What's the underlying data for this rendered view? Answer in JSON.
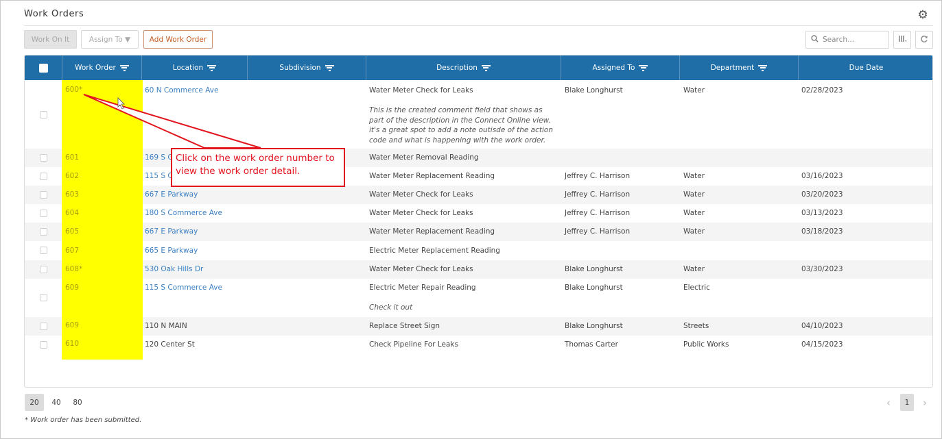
{
  "page": {
    "title": "Work Orders"
  },
  "toolbar": {
    "work_on_it": "Work On It",
    "assign_to": "Assign To ▼",
    "add_work_order": "Add Work Order",
    "search_placeholder": "Search..."
  },
  "columns": [
    "Work Order",
    "Location",
    "Subdivision",
    "Description",
    "Assigned To",
    "Department",
    "Due Date"
  ],
  "rows": [
    {
      "wo": "600*",
      "location": "60 N Commerce Ave",
      "location_link": true,
      "subdivision": "",
      "description": "Water Meter Check for Leaks",
      "note": "This is the created comment field that shows as part of the description in the Connect Online view. it's a great spot to add a note outisde of the action code and what is happening with the work order.",
      "assigned": "Blake Longhurst",
      "department": "Water",
      "due": "02/28/2023"
    },
    {
      "wo": "601",
      "location": "169 S Co",
      "location_link": true,
      "subdivision": "",
      "description": "Water Meter Removal Reading",
      "note": "",
      "assigned": "",
      "department": "",
      "due": ""
    },
    {
      "wo": "602",
      "location": "115 S Co",
      "location_link": true,
      "subdivision": "",
      "description": "Water Meter Replacement Reading",
      "note": "",
      "assigned": "Jeffrey C. Harrison",
      "department": "Water",
      "due": "03/16/2023"
    },
    {
      "wo": "603",
      "location": "667 E Parkway",
      "location_link": true,
      "subdivision": "",
      "description": "Water Meter Check for Leaks",
      "note": "",
      "assigned": "Jeffrey C. Harrison",
      "department": "Water",
      "due": "03/20/2023"
    },
    {
      "wo": "604",
      "location": "180 S Commerce Ave",
      "location_link": true,
      "subdivision": "",
      "description": "Water Meter Check for Leaks",
      "note": "",
      "assigned": "Jeffrey C. Harrison",
      "department": "Water",
      "due": "03/13/2023"
    },
    {
      "wo": "605",
      "location": "667 E Parkway",
      "location_link": true,
      "subdivision": "",
      "description": "Water Meter Replacement Reading",
      "note": "",
      "assigned": "Jeffrey C. Harrison",
      "department": "Water",
      "due": "03/18/2023"
    },
    {
      "wo": "607",
      "location": "665 E Parkway",
      "location_link": true,
      "subdivision": "",
      "description": "Electric Meter Replacement Reading",
      "note": "",
      "assigned": "",
      "department": "",
      "due": ""
    },
    {
      "wo": "608*",
      "location": "530 Oak Hills Dr",
      "location_link": true,
      "subdivision": "",
      "description": "Water Meter Check for Leaks",
      "note": "",
      "assigned": "Blake Longhurst",
      "department": "Water",
      "due": "03/30/2023"
    },
    {
      "wo": "609",
      "location": "115 S Commerce Ave",
      "location_link": true,
      "subdivision": "",
      "description": "Electric Meter Repair Reading",
      "note": "Check it out",
      "assigned": "Blake Longhurst",
      "department": "Electric",
      "due": ""
    },
    {
      "wo": "609",
      "location": "110 N MAIN",
      "location_link": false,
      "subdivision": "",
      "description": "Replace Street Sign",
      "note": "",
      "assigned": "Blake Longhurst",
      "department": "Streets",
      "due": "04/10/2023"
    },
    {
      "wo": "610",
      "location": "120 Center St",
      "location_link": false,
      "subdivision": "",
      "description": "Check Pipeline For Leaks",
      "note": "",
      "assigned": "Thomas Carter",
      "department": "Public Works",
      "due": "04/15/2023"
    }
  ],
  "callout": {
    "text": "Click on the work order number to view the work order detail."
  },
  "pagination": {
    "page_sizes": [
      "20",
      "40",
      "80"
    ],
    "selected_size": "20",
    "current_page": "1",
    "prev": "‹",
    "next": "›"
  },
  "footnote": "* Work order has been submitted.",
  "icons": {
    "settings": "gear-icon",
    "search": "search-icon",
    "columns": "columns-icon",
    "refresh": "refresh-icon",
    "filter": "filter-icon"
  },
  "colors": {
    "header_bg": "#1f6ea7",
    "link": "#3b80c3",
    "highlight": "#ffff00",
    "callout": "#e2141c",
    "add_button": "#c65b1f"
  }
}
